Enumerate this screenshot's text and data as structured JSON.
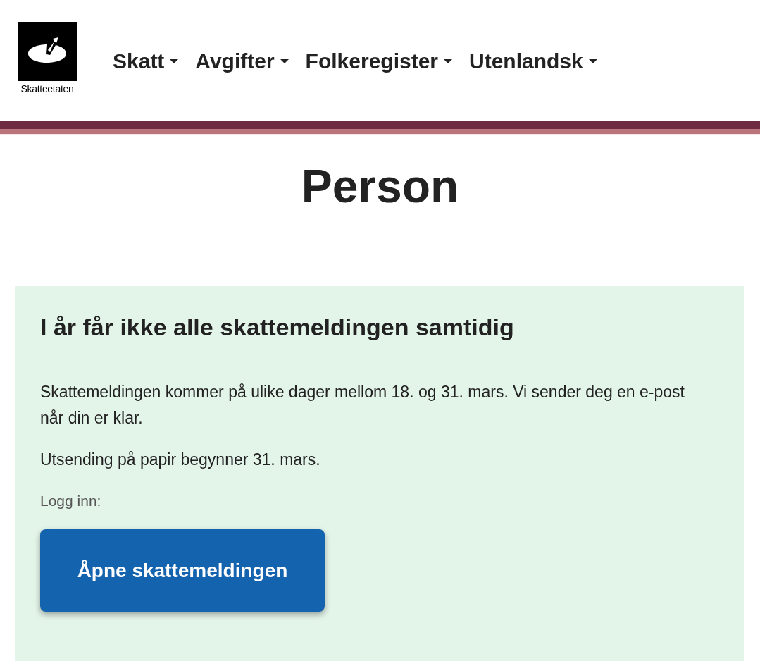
{
  "logo": {
    "text": "Skatteetaten"
  },
  "nav": [
    {
      "label": "Skatt",
      "expanded": false
    },
    {
      "label": "Avgifter",
      "expanded": false
    },
    {
      "label": "Folkeregister",
      "expanded": false
    },
    {
      "label": "Utenlandsk",
      "expanded": false
    }
  ],
  "page_title": "Person",
  "notice": {
    "heading": "I år får ikke alle skattemeldingen samtidig",
    "paragraphs": [
      "Skattemeldingen kommer på ulike dager mellom 18. og 31. mars. Vi sender deg en e-post når din er klar.",
      "Utsending på papir begynner 31. mars."
    ],
    "login_label": "Logg inn:",
    "button": "Åpne skattemeldingen"
  }
}
